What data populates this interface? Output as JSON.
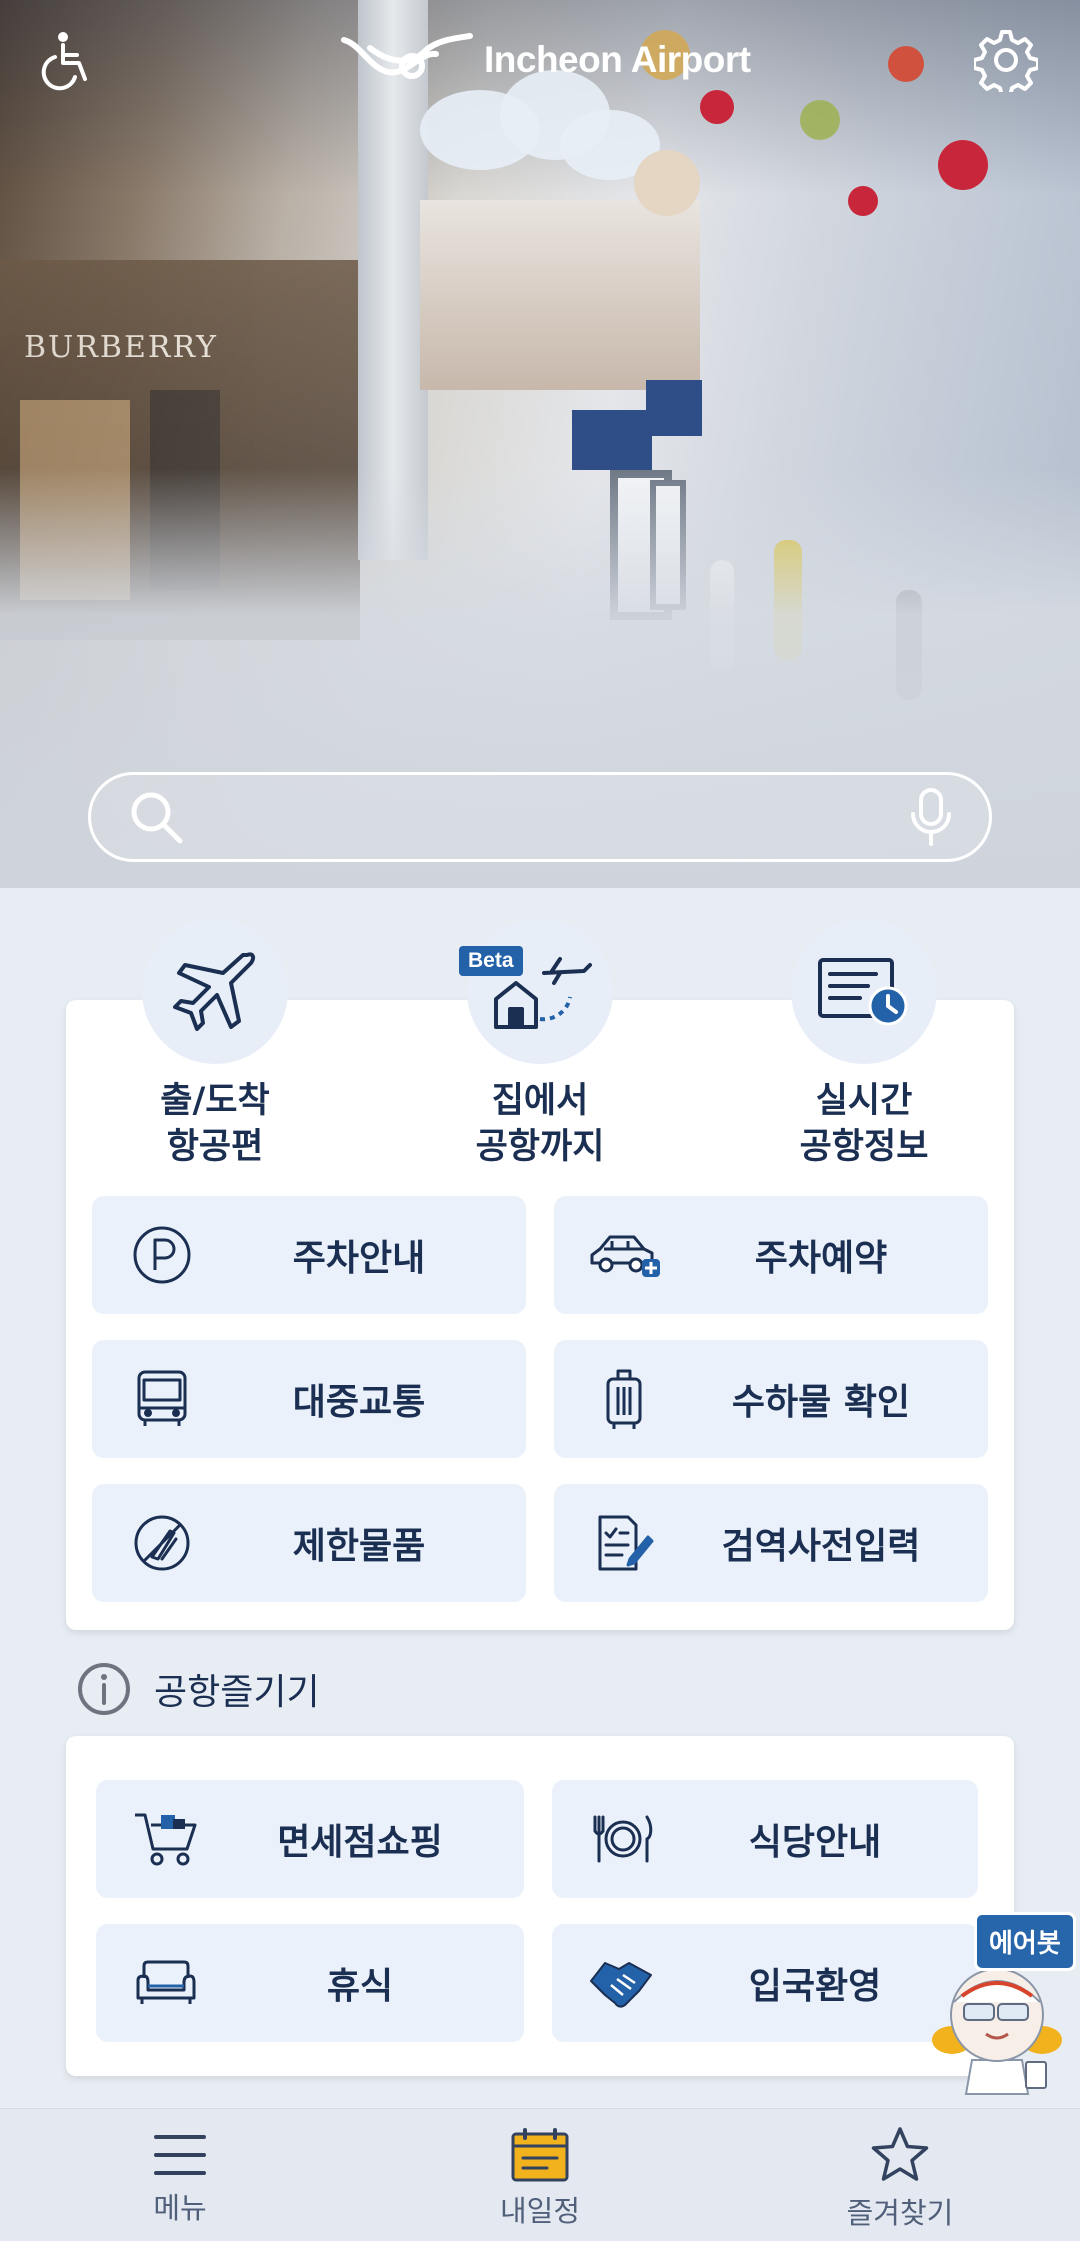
{
  "header": {
    "logo_text": "Incheon Airport",
    "accessibility_icon": "wheelchair-icon",
    "settings_icon": "gear-icon"
  },
  "hero": {
    "shop_sign": "BURBERRY",
    "search_placeholder": ""
  },
  "quick_menu": [
    {
      "label": "출/도착\n항공편",
      "icon": "airplane-icon"
    },
    {
      "label": "집에서\n공항까지",
      "icon": "home-to-airport-icon",
      "badge": "Beta"
    },
    {
      "label": "실시간\n공항정보",
      "icon": "realtime-info-icon"
    }
  ],
  "services": [
    {
      "label": "주차안내",
      "icon": "parking-icon"
    },
    {
      "label": "주차예약",
      "icon": "car-reserve-icon"
    },
    {
      "label": "대중교통",
      "icon": "bus-icon"
    },
    {
      "label": "수하물 확인",
      "icon": "luggage-icon"
    },
    {
      "label": "제한물품",
      "icon": "prohibited-items-icon"
    },
    {
      "label": "검역사전입력",
      "icon": "quarantine-form-icon"
    }
  ],
  "enjoy_section": {
    "title": "공항즐기기",
    "items": [
      {
        "label": "면세점쇼핑",
        "icon": "shopping-cart-icon"
      },
      {
        "label": "식당안내",
        "icon": "restaurant-icon"
      },
      {
        "label": "휴식",
        "icon": "sofa-icon"
      },
      {
        "label": "입국환영",
        "icon": "handshake-icon"
      }
    ]
  },
  "airbot": {
    "label": "에어봇"
  },
  "bottom_nav": [
    {
      "label": "메뉴",
      "icon": "hamburger-menu-icon"
    },
    {
      "label": "내일정",
      "icon": "calendar-icon"
    },
    {
      "label": "즐겨찾기",
      "icon": "star-icon"
    }
  ],
  "colors": {
    "primary": "#1b2f52",
    "accent_blue": "#2361a8",
    "tile_bg": "#eaf1fa",
    "page_bg": "#e8edf4"
  }
}
